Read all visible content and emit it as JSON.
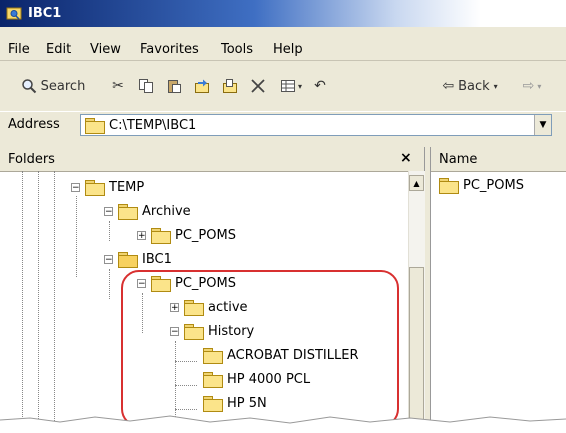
{
  "window": {
    "title": "IBC1"
  },
  "menu": [
    "File",
    "Edit",
    "View",
    "Favorites",
    "Tools",
    "Help"
  ],
  "toolbar": {
    "search_label": "Search",
    "back_label": "Back"
  },
  "address": {
    "label": "Address",
    "value": "C:\\TEMP\\IBC1"
  },
  "folders": {
    "title": "Folders",
    "close": "×",
    "items": [
      "TEMP",
      "Archive",
      "PC_POMS",
      "IBC1",
      "PC_POMS",
      "active",
      "History",
      "ACROBAT DISTILLER",
      "HP 4000 PCL",
      "HP 5N"
    ]
  },
  "files": {
    "column_name": "Name",
    "items": [
      "PC_POMS"
    ]
  },
  "colors": {
    "highlight": "#d83030",
    "title_bar": "#0a246a",
    "folder": "#fbe48a"
  }
}
